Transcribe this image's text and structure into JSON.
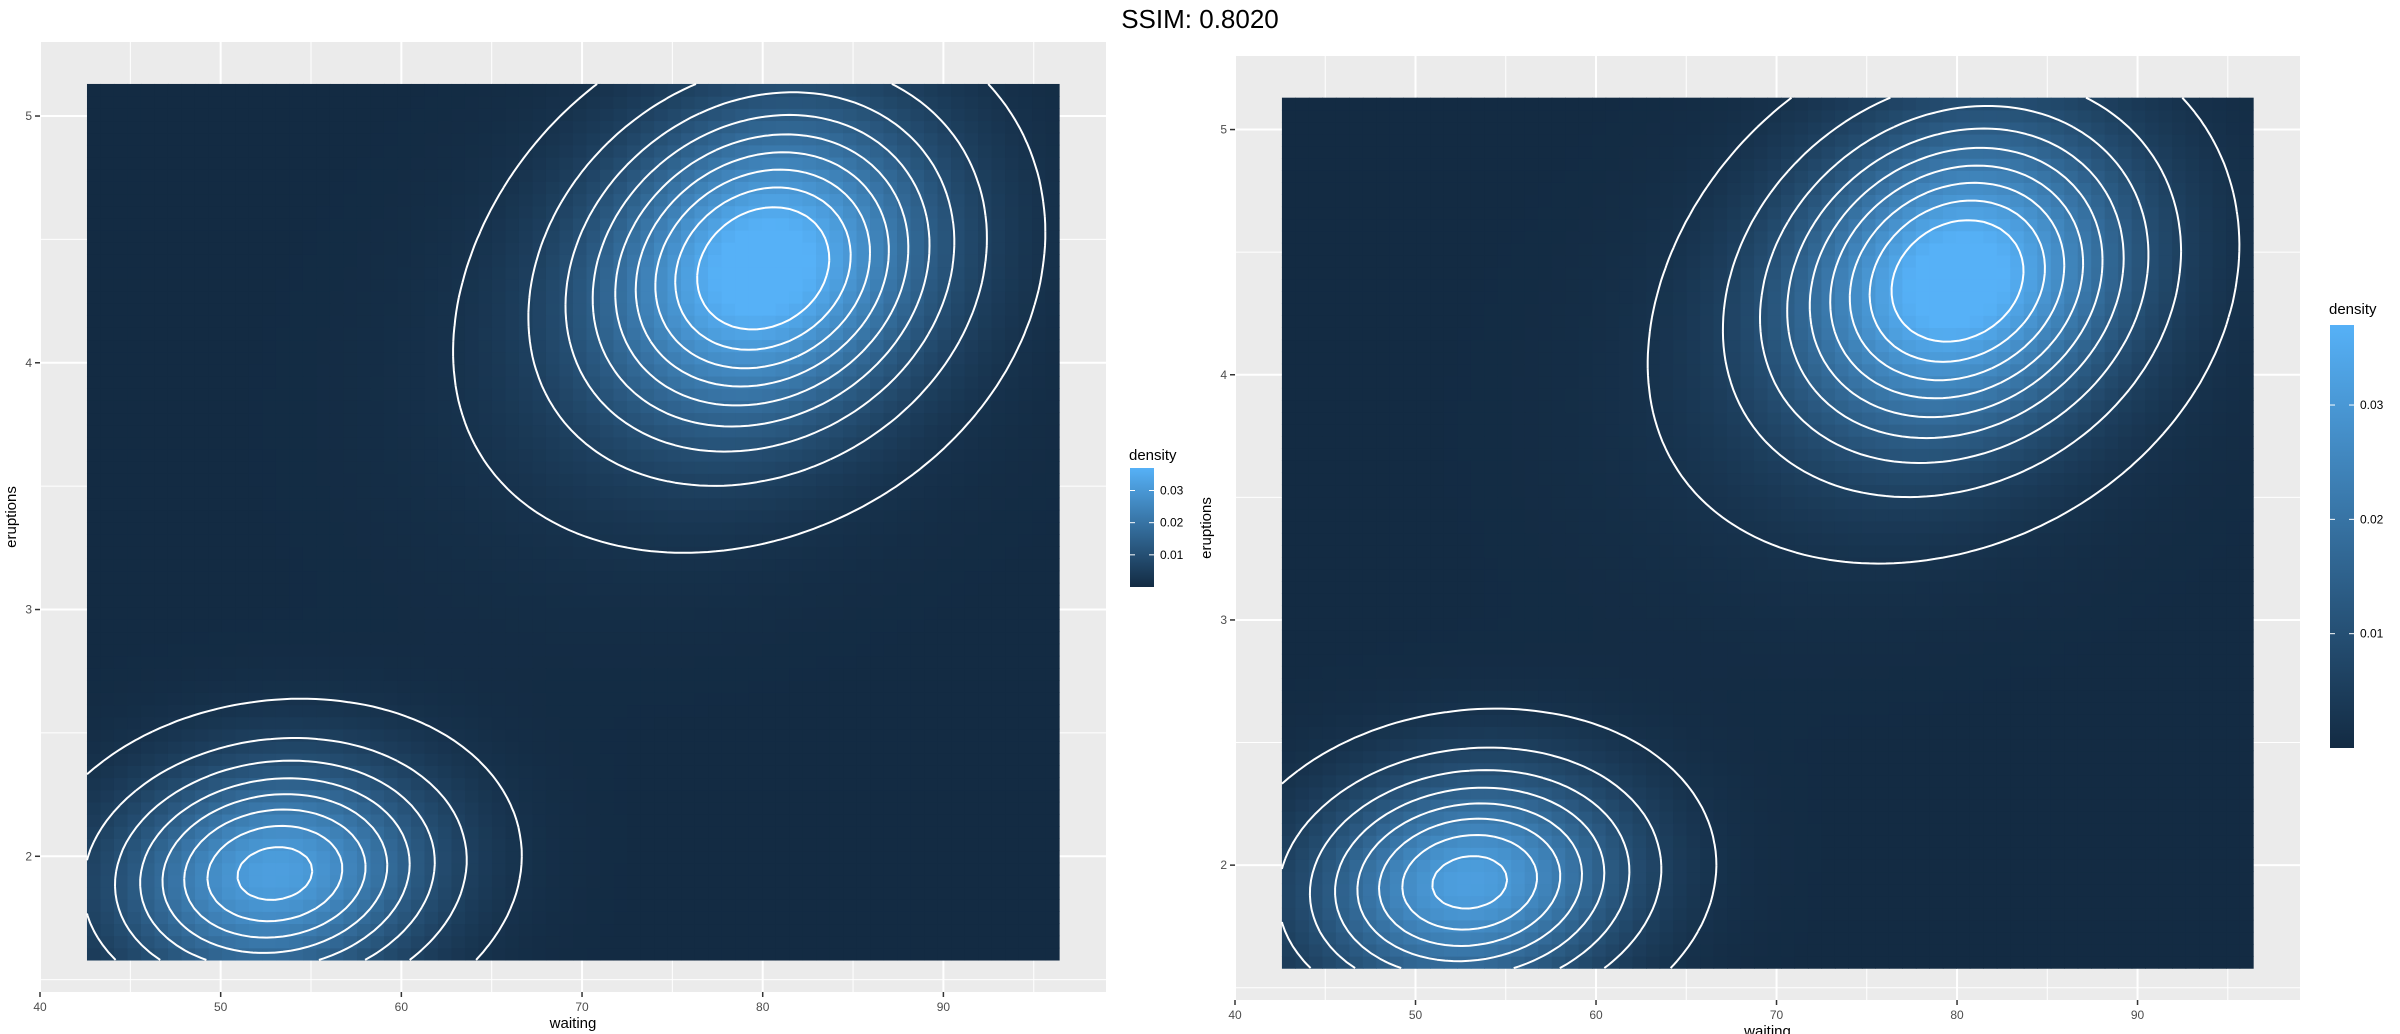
{
  "page_title": "SSIM: 0.8020",
  "colors": {
    "panel_background": "#ebebeb",
    "grid_line": "#ffffff",
    "density_low": "#132b43",
    "density_high": "#56b1f7",
    "contour": "#ffffff"
  },
  "chart_data": [
    {
      "type": "heatmap",
      "title": "",
      "xlabel": "waiting",
      "ylabel": "eruptions",
      "xlim": [
        40,
        99
      ],
      "ylim": [
        1.45,
        5.3
      ],
      "x_ticks": [
        "40",
        "50",
        "60",
        "70",
        "80",
        "90"
      ],
      "y_ticks": [
        "2",
        "3",
        "4",
        "5"
      ],
      "x_tick_values": [
        40,
        50,
        60,
        70,
        80,
        90
      ],
      "y_tick_values": [
        2,
        3,
        4,
        5
      ],
      "raster_extent": {
        "x": [
          42.6,
          96.4
        ],
        "y": [
          1.58,
          5.13
        ]
      },
      "grid": true,
      "legend": {
        "title": "density",
        "labels": [
          "0.01",
          "0.02",
          "0.03"
        ],
        "values": [
          0.01,
          0.02,
          0.03
        ],
        "max": 0.037,
        "position": "right"
      },
      "density_peaks": [
        {
          "waiting": 80.2,
          "eruptions": 4.4,
          "density": 0.037
        },
        {
          "waiting": 53.0,
          "eruptions": 1.93,
          "density": 0.032
        }
      ],
      "contour_levels": [
        0.002,
        0.006,
        0.01,
        0.014,
        0.018,
        0.022,
        0.026,
        0.03,
        0.034
      ]
    },
    {
      "type": "heatmap",
      "title": "",
      "xlabel": "waiting",
      "ylabel": "eruptions",
      "xlim": [
        40,
        99
      ],
      "ylim": [
        1.45,
        5.3
      ],
      "x_ticks": [
        "40",
        "50",
        "60",
        "70",
        "80",
        "90"
      ],
      "y_ticks": [
        "2",
        "3",
        "4",
        "5"
      ],
      "x_tick_values": [
        40,
        50,
        60,
        70,
        80,
        90
      ],
      "y_tick_values": [
        2,
        3,
        4,
        5
      ],
      "raster_extent": {
        "x": [
          42.6,
          96.4
        ],
        "y": [
          1.58,
          5.13
        ]
      },
      "grid": true,
      "legend": {
        "title": "density",
        "labels": [
          "0.01",
          "0.02",
          "0.03"
        ],
        "values": [
          0.01,
          0.02,
          0.03
        ],
        "max": 0.037,
        "position": "right"
      },
      "density_peaks": [
        {
          "waiting": 80.2,
          "eruptions": 4.4,
          "density": 0.037
        },
        {
          "waiting": 53.0,
          "eruptions": 1.93,
          "density": 0.032
        }
      ],
      "contour_levels": [
        0.002,
        0.006,
        0.01,
        0.014,
        0.018,
        0.022,
        0.026,
        0.03,
        0.034
      ]
    }
  ]
}
